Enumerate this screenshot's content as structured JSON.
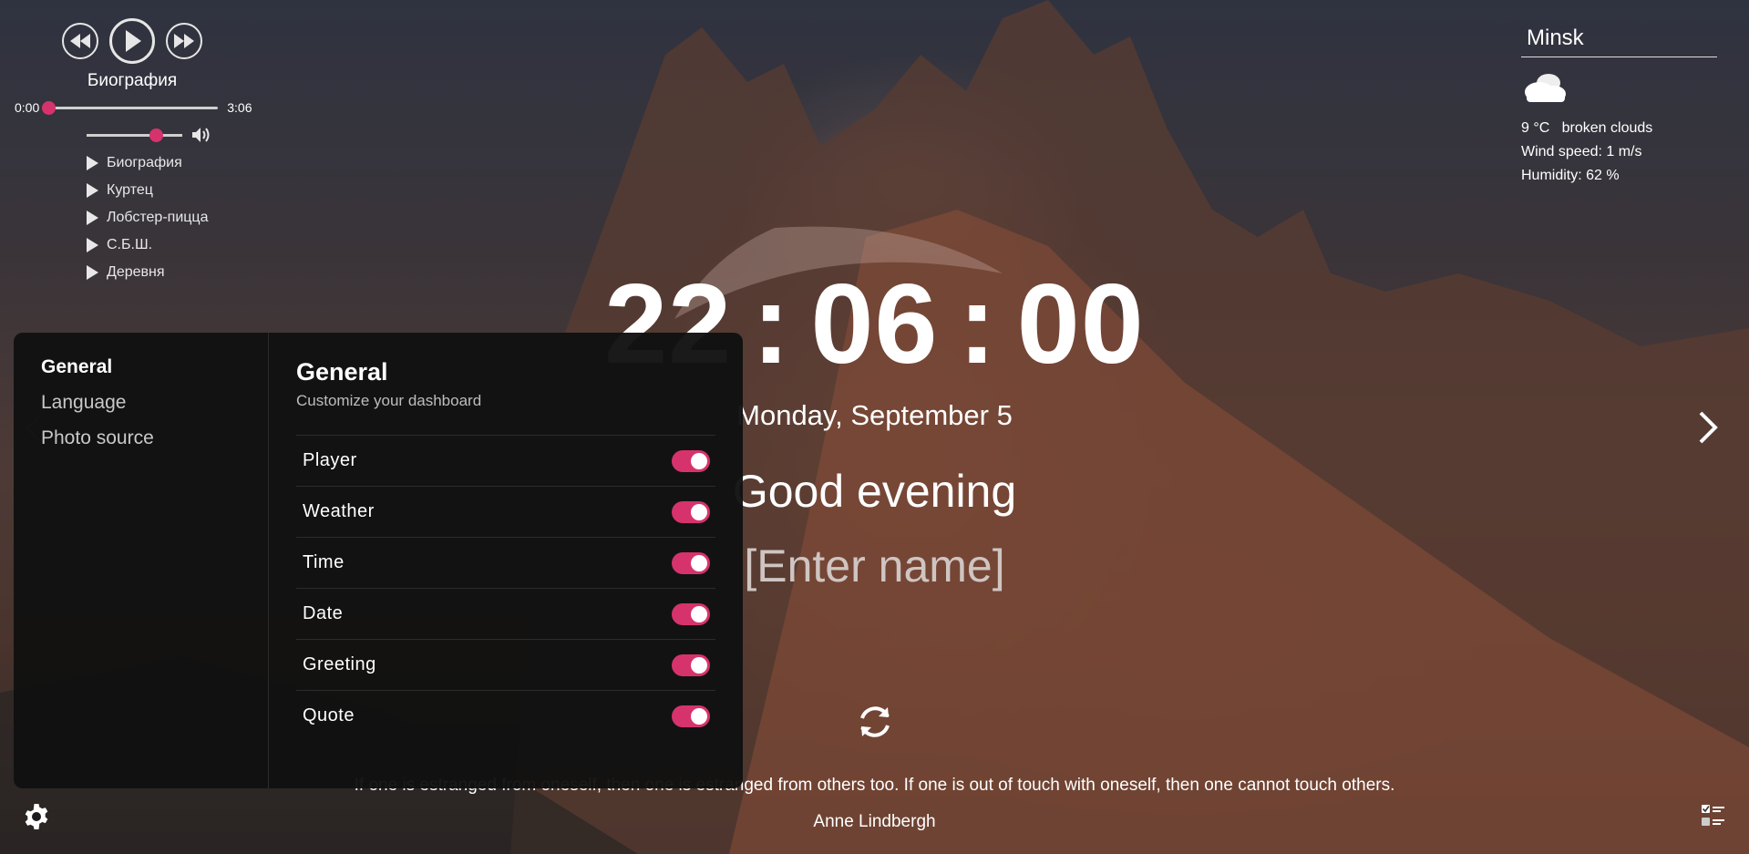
{
  "player": {
    "track_title": "Биография",
    "current_time": "0:00",
    "duration": "3:06",
    "progress": 0,
    "volume": 0.72,
    "playlist": [
      {
        "title": "Биография"
      },
      {
        "title": "Куртец"
      },
      {
        "title": "Лобстер-пицца"
      },
      {
        "title": "С.Б.Ш."
      },
      {
        "title": "Деревня"
      }
    ],
    "icons": {
      "prev": "rewind-icon",
      "play": "play-icon",
      "next": "fast-forward-icon",
      "volume": "volume-icon"
    }
  },
  "weather": {
    "city": "Minsk",
    "temperature": "9 °C",
    "description": "broken clouds",
    "wind": "Wind speed: 1 m/s",
    "humidity": "Humidity: 62 %",
    "icon": "broken-clouds-icon"
  },
  "clock": {
    "hours": "22",
    "minutes": "06",
    "seconds": "00",
    "separator": ":"
  },
  "date": "Monday, September 5",
  "greeting": "Good evening",
  "name_placeholder": "[Enter name]",
  "quote": {
    "text": "If one is estranged from oneself, then one is estranged from others too. If one is out of touch with oneself, then one cannot touch others.",
    "author": "Anne Lindbergh"
  },
  "settings": {
    "nav": [
      {
        "label": "General",
        "active": true
      },
      {
        "label": "Language",
        "active": false
      },
      {
        "label": "Photo source",
        "active": false
      }
    ],
    "title": "General",
    "subtitle": "Customize your dashboard",
    "toggles": [
      {
        "label": "Player",
        "on": true
      },
      {
        "label": "Weather",
        "on": true
      },
      {
        "label": "Time",
        "on": true
      },
      {
        "label": "Date",
        "on": true
      },
      {
        "label": "Greeting",
        "on": true
      },
      {
        "label": "Quote",
        "on": true
      }
    ]
  },
  "colors": {
    "accent": "#d6336c",
    "panel_bg": "#111111",
    "text": "#ffffff"
  }
}
